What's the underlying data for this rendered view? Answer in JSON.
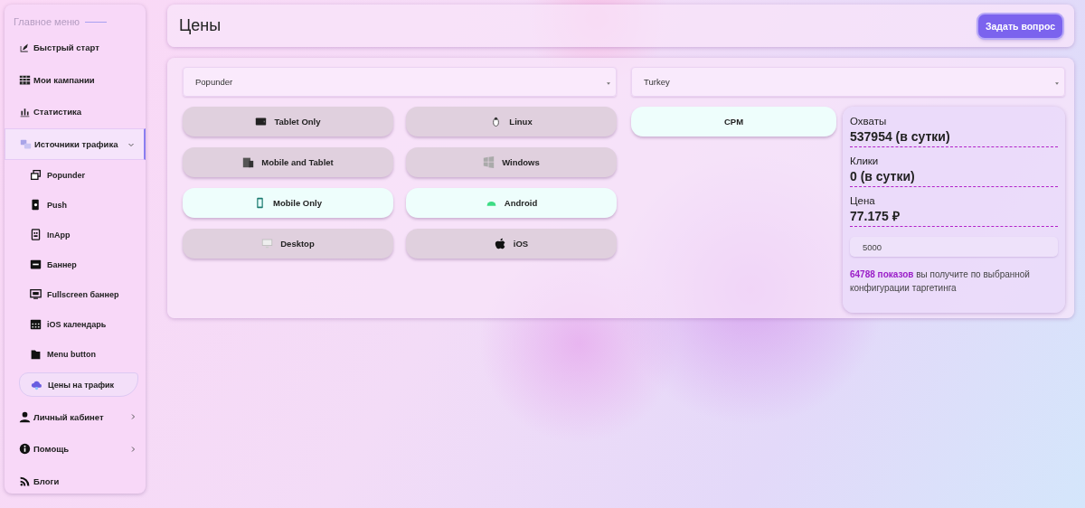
{
  "sidebar": {
    "heading": "Главное меню",
    "items": [
      {
        "kind": "link",
        "label": "Быстрый старт",
        "selected": false
      },
      {
        "kind": "link",
        "label": "Мои кампании",
        "selected": false
      },
      {
        "kind": "link",
        "label": "Статистика",
        "selected": false
      },
      {
        "kind": "group",
        "label": "Источники трафика",
        "selected": true,
        "expanded": true,
        "children": [
          {
            "label": "Popunder",
            "selected": false
          },
          {
            "label": "Push",
            "selected": false
          },
          {
            "label": "InApp",
            "selected": false
          },
          {
            "label": "Баннер",
            "selected": false
          },
          {
            "label": "Fullscreen баннер",
            "selected": false
          },
          {
            "label": "iOS календарь",
            "selected": false
          },
          {
            "label": "Menu button",
            "selected": false
          },
          {
            "label": "Цены на трафик",
            "selected": true
          }
        ]
      },
      {
        "kind": "group",
        "label": "Личный кабинет",
        "selected": false,
        "expanded": false
      },
      {
        "kind": "group",
        "label": "Помощь",
        "selected": false,
        "expanded": false
      },
      {
        "kind": "link",
        "label": "Блоги",
        "selected": false
      }
    ]
  },
  "header": {
    "title": "Цены",
    "button": "Задать вопрос"
  },
  "filters": {
    "format": "Popunder",
    "country": "Turkey"
  },
  "devices": [
    {
      "label": "Tablet Only",
      "selected": false
    },
    {
      "label": "Mobile and Tablet",
      "selected": false
    },
    {
      "label": "Mobile Only",
      "selected": true
    },
    {
      "label": "Desktop",
      "selected": false
    }
  ],
  "os": [
    {
      "label": "Linux",
      "selected": false
    },
    {
      "label": "Windows",
      "selected": false
    },
    {
      "label": "Android",
      "selected": true
    },
    {
      "label": "iOS",
      "selected": false
    }
  ],
  "pricing_models": [
    {
      "label": "CPM",
      "selected": true
    }
  ],
  "stats": [
    {
      "label": "Охваты",
      "value": "537954 (в сутки)"
    },
    {
      "label": "Клики",
      "value": "0 (в сутки)"
    },
    {
      "label": "Цена",
      "value": "77.175 ₽"
    }
  ],
  "budget": "5000",
  "summary": "**64788 показов** вы получите по выбранной конфигурации таргетинга"
}
